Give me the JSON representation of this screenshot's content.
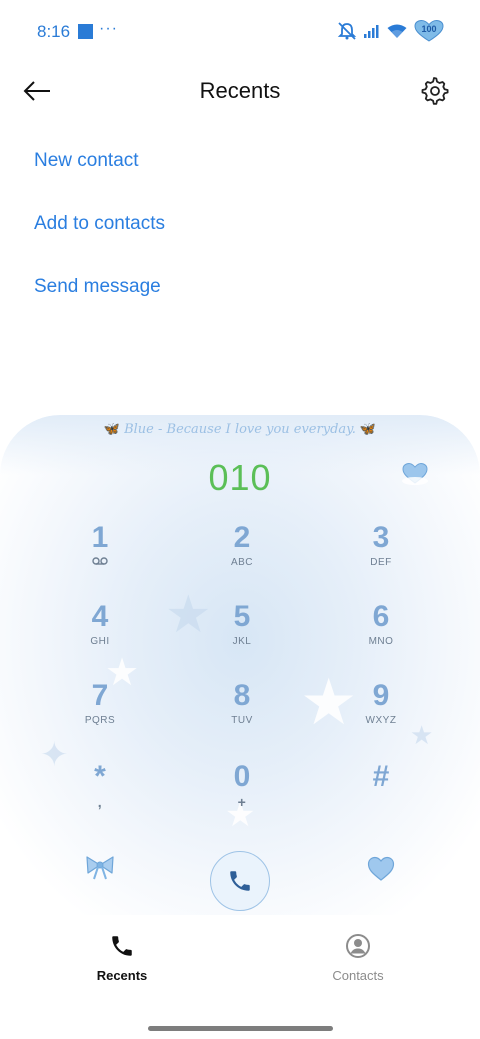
{
  "status_bar": {
    "time": "8:16",
    "dots": "···",
    "battery_level": "100",
    "icons": [
      "notification-square-icon",
      "mute-icon",
      "signal-icon",
      "wifi-icon",
      "battery-heart-icon"
    ]
  },
  "header": {
    "title": "Recents",
    "back_icon": "arrow-left-icon",
    "settings_icon": "gear-icon"
  },
  "actions": [
    {
      "label": "New contact"
    },
    {
      "label": "Add to contacts"
    },
    {
      "label": "Send message"
    }
  ],
  "dialer": {
    "banner_text": "Blue - Because I love you everyday.",
    "number": "010",
    "keys": [
      {
        "digit": "1",
        "letters": "",
        "icon": "voicemail-icon"
      },
      {
        "digit": "2",
        "letters": "ABC"
      },
      {
        "digit": "3",
        "letters": "DEF"
      },
      {
        "digit": "4",
        "letters": "GHI"
      },
      {
        "digit": "5",
        "letters": "JKL"
      },
      {
        "digit": "6",
        "letters": "MNO"
      },
      {
        "digit": "7",
        "letters": "PQRS"
      },
      {
        "digit": "8",
        "letters": "TUV"
      },
      {
        "digit": "9",
        "letters": "WXYZ"
      },
      {
        "digit": "*",
        "letters": ","
      },
      {
        "digit": "0",
        "letters": "+"
      },
      {
        "digit": "#",
        "letters": ""
      }
    ],
    "accent_color": "#7fa7d3",
    "number_color": "#5bbf57"
  },
  "bottom_nav": {
    "recents_label": "Recents",
    "contacts_label": "Contacts",
    "active": "Recents"
  }
}
